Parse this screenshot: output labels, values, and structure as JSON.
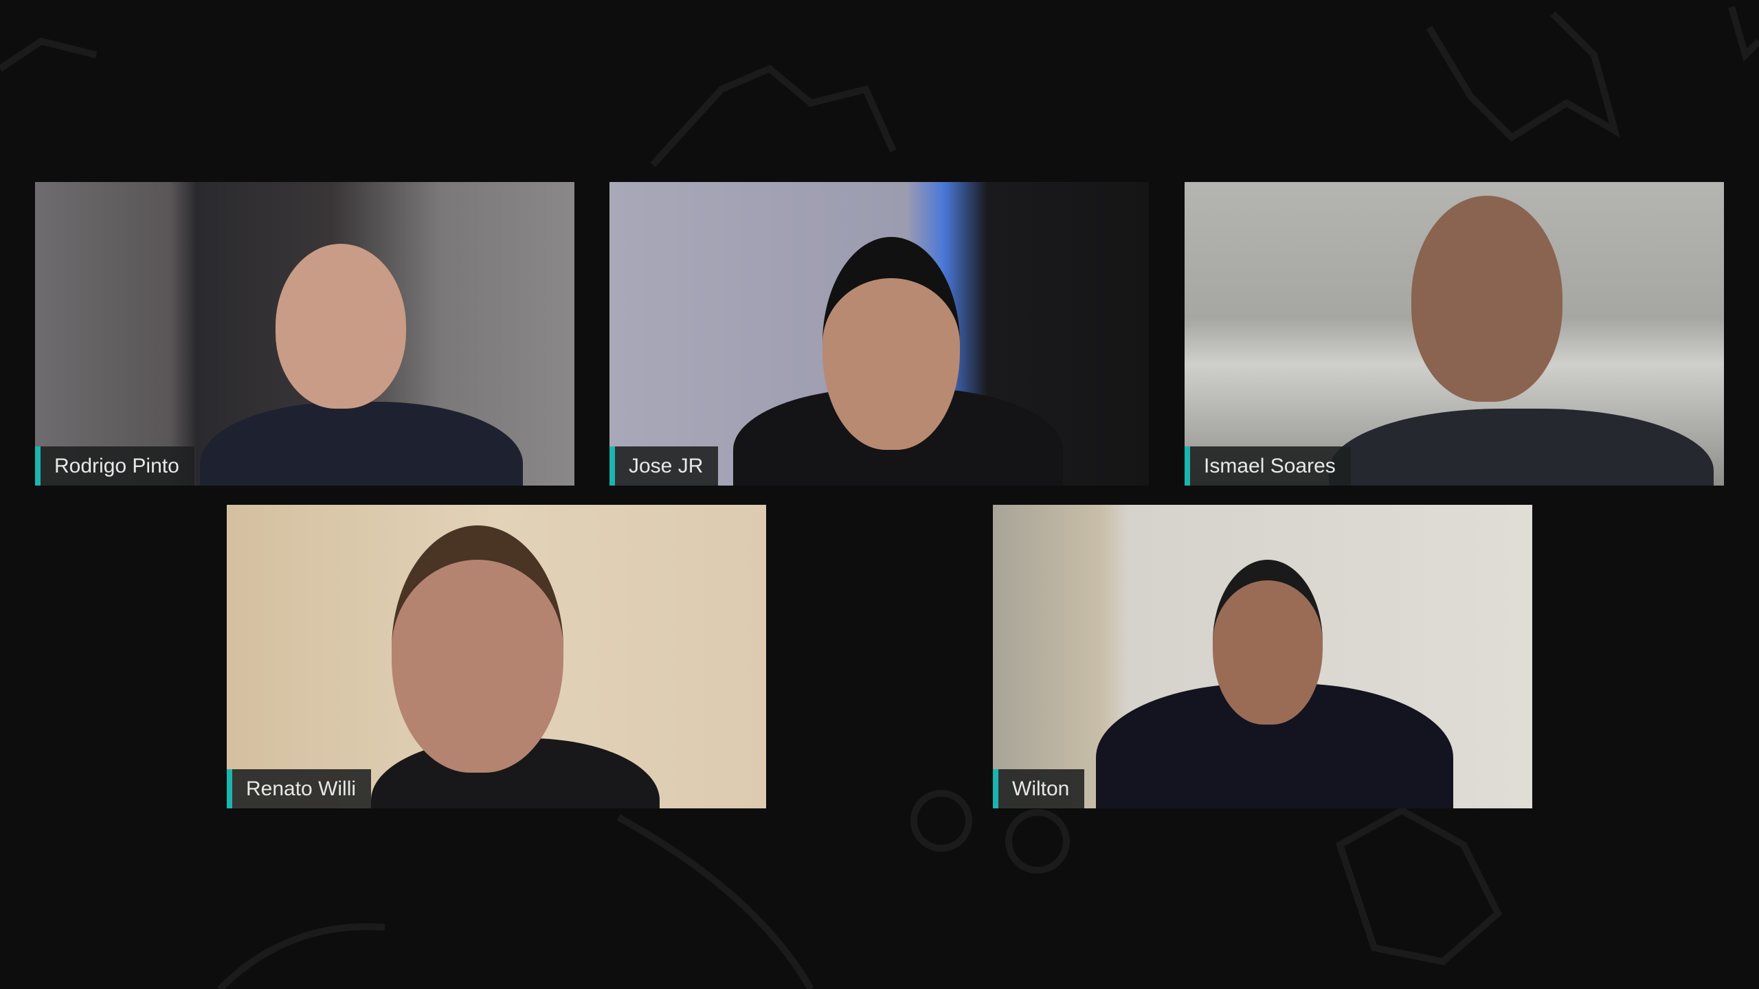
{
  "participants": [
    {
      "name": "Rodrigo Pinto"
    },
    {
      "name": "Jose JR"
    },
    {
      "name": "Ismael Soares"
    },
    {
      "name": "Renato Willi"
    },
    {
      "name": "Wilton"
    }
  ],
  "colors": {
    "background": "#0d0d0d",
    "name_accent": "#1bb5b0",
    "decor": "#1c1c1c"
  }
}
